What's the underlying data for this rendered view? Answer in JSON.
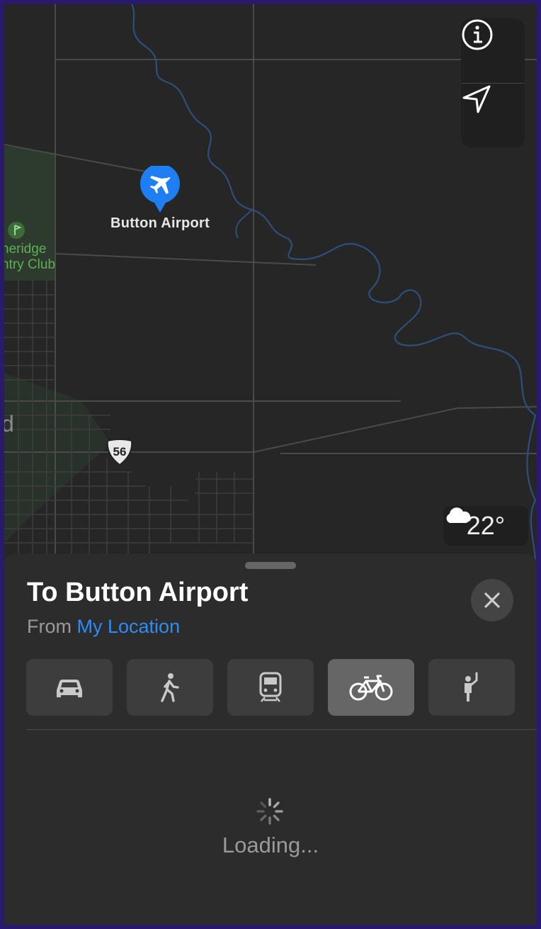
{
  "map": {
    "place_label": "Button Airport",
    "club_label_line1": "neridge",
    "club_label_line2": "ntry Club",
    "town_letter": "d",
    "route_shield": "56",
    "weather_temp": "22°",
    "icons": [
      "info-icon",
      "location-arrow-icon",
      "airplane-icon",
      "golf-icon",
      "cloud-icon"
    ]
  },
  "sheet": {
    "title": "To Button Airport",
    "from_prefix": "From",
    "from_location": "My Location",
    "modes": [
      {
        "name": "drive",
        "icon": "car-icon",
        "selected": false
      },
      {
        "name": "walk",
        "icon": "walking-icon",
        "selected": false
      },
      {
        "name": "transit",
        "icon": "train-icon",
        "selected": false
      },
      {
        "name": "cycle",
        "icon": "bicycle-icon",
        "selected": true
      },
      {
        "name": "ride-share",
        "icon": "hailing-person-icon",
        "selected": false
      }
    ],
    "status": "Loading..."
  },
  "colors": {
    "accent": "#2f8cf5",
    "club_green": "#5fae55",
    "background": "#262626"
  }
}
